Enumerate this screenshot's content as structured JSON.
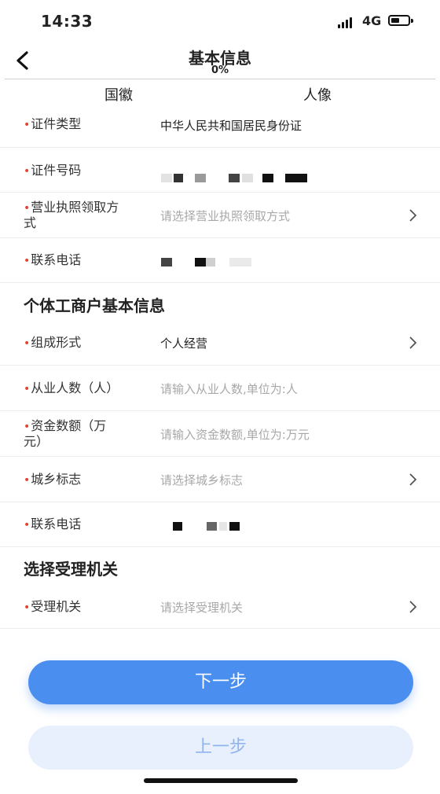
{
  "status_bar": {
    "time": "14:33",
    "network": "4G"
  },
  "nav": {
    "title": "基本信息",
    "progress": "0%"
  },
  "tabs": [
    "国徽",
    "人像"
  ],
  "identity": {
    "id_type": {
      "label": "证件类型",
      "value": "中华人民共和国居民身份证"
    },
    "id_number": {
      "label": "证件号码"
    },
    "license_method": {
      "label_line1": "营业执照领取方",
      "label_line2": "式",
      "placeholder": "请选择营业执照领取方式"
    },
    "phone": {
      "label": "联系电话"
    }
  },
  "business_section": {
    "title": "个体工商户基本信息",
    "composition": {
      "label": "组成形式",
      "value": "个人经营"
    },
    "employees": {
      "label": "从业人数（人）",
      "placeholder": "请输入从业人数,单位为:人"
    },
    "capital": {
      "label_line1": "资金数额（万",
      "label_line2": "元）",
      "placeholder": "请输入资金数额,单位为:万元"
    },
    "urban_rural": {
      "label": "城乡标志",
      "placeholder": "请选择城乡标志"
    },
    "phone": {
      "label": "联系电话"
    }
  },
  "authority_section": {
    "title": "选择受理机关",
    "authority": {
      "label": "受理机关",
      "placeholder": "请选择受理机关"
    }
  },
  "buttons": {
    "next": "下一步",
    "prev": "上一步"
  },
  "colors": {
    "primary": "#4a8ff0",
    "required": "#e8412f",
    "placeholder": "#a8a8a8"
  }
}
